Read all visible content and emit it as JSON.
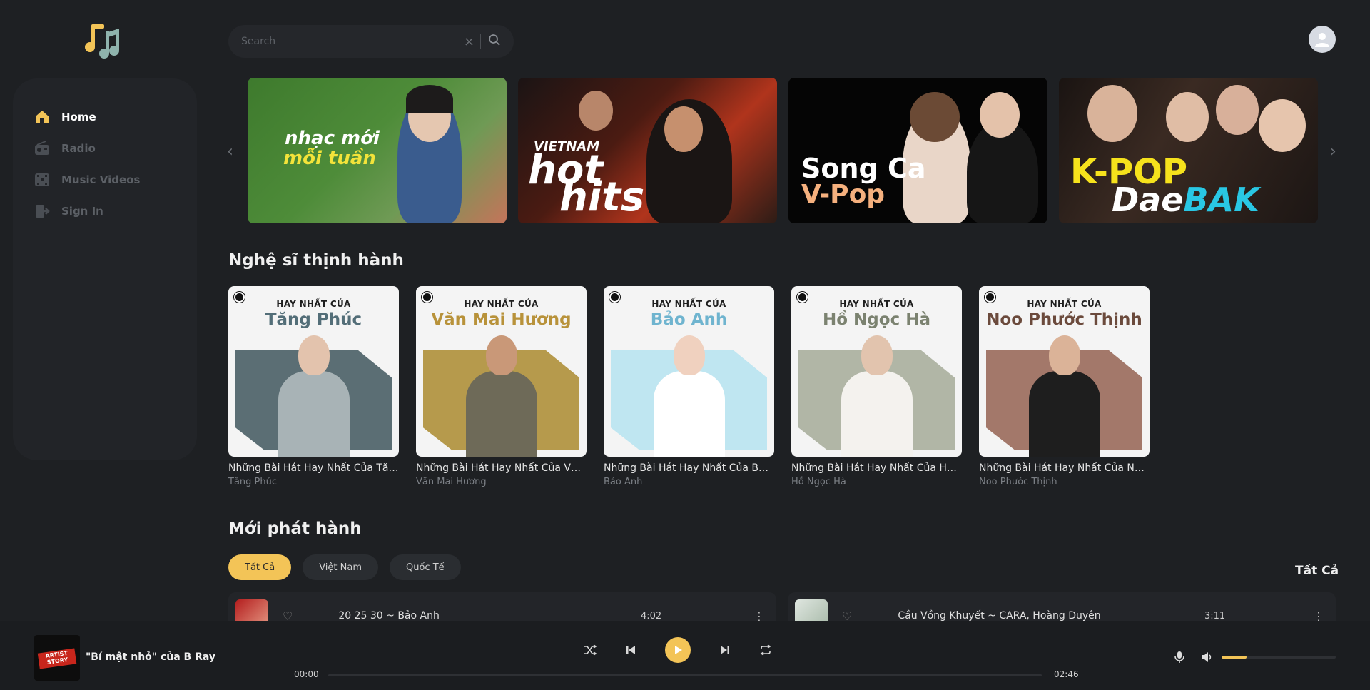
{
  "search": {
    "placeholder": "Search"
  },
  "sidebar": {
    "items": [
      {
        "label": "Home",
        "active": true
      },
      {
        "label": "Radio"
      },
      {
        "label": "Music Videos"
      },
      {
        "label": "Sign In"
      }
    ]
  },
  "banners": [
    {
      "line1": "nhạc mới",
      "line2": "mỗi tuần"
    },
    {
      "line1": "VIETNAM",
      "line2": "hot",
      "line3": "hits"
    },
    {
      "line1": "Song Ca",
      "line2": "V-Pop"
    },
    {
      "line1": "K-POP",
      "line2": "Dae",
      "line3": "BAK"
    }
  ],
  "trending": {
    "title": "Nghệ sĩ thịnh hành",
    "kicker": "HAY NHẤT CỦA",
    "artists": [
      {
        "name": "Tăng Phúc",
        "title": "Những Bài Hát Hay Nhất Của Tăng...",
        "subtitle": "Tăng Phúc",
        "nameColor": "#536e78",
        "bg": "#5b6e74",
        "skin": "#e3c3ad",
        "cloth": "#a8b3b6"
      },
      {
        "name": "Văn Mai Hương",
        "title": "Những Bài Hát Hay Nhất Của Văn...",
        "subtitle": "Văn Mai Hương",
        "nameColor": "#b8923a",
        "bg": "#b69a4c",
        "skin": "#c99878",
        "cloth": "#6e6a58"
      },
      {
        "name": "Bảo Anh",
        "title": "Những Bài Hát Hay Nhất Của Bảo...",
        "subtitle": "Bảo Anh",
        "nameColor": "#6fb4cf",
        "bg": "#bfe6f1",
        "skin": "#f0d1bf",
        "cloth": "#ffffff"
      },
      {
        "name": "Hồ Ngọc Hà",
        "title": "Những Bài Hát Hay Nhất Của Hồ...",
        "subtitle": "Hồ Ngọc Hà",
        "nameColor": "#7b8270",
        "bg": "#b1b6a6",
        "skin": "#e2c4ae",
        "cloth": "#f4f2ee"
      },
      {
        "name": "Noo Phước Thịnh",
        "title": "Những Bài Hát Hay Nhất Của Noo...",
        "subtitle": "Noo Phước Thịnh",
        "nameColor": "#6b4a3c",
        "bg": "#a3786a",
        "skin": "#dbb398",
        "cloth": "#1e1e1e"
      }
    ]
  },
  "new_release": {
    "title": "Mới phát hành",
    "filters": [
      {
        "label": "Tất Cả",
        "active": true
      },
      {
        "label": "Việt Nam"
      },
      {
        "label": "Quốc Tế"
      }
    ],
    "see_all": "Tất Cả",
    "songs": [
      {
        "title": "20 25 30 ~ Bảo Anh",
        "duration": "4:02"
      },
      {
        "title": "Cầu Vồng Khuyết ~ CARA, Hoàng Duyên",
        "duration": "3:11"
      }
    ]
  },
  "player": {
    "track": "\"Bí mật nhỏ\" của B Ray",
    "thumb_text": "ARTIST STORY",
    "elapsed": "00:00",
    "total": "02:46",
    "progress": 0,
    "volume": 0.22
  },
  "colors": {
    "accent": "#f3c457",
    "bg": "#1e2023"
  }
}
